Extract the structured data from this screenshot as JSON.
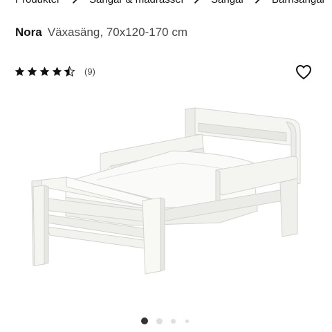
{
  "breadcrumb": {
    "items": [
      {
        "label": "Produkter"
      },
      {
        "label": "Sängar & madrasser"
      },
      {
        "label": "Sängar"
      },
      {
        "label": "Barnsängar"
      }
    ]
  },
  "product": {
    "name": "Nora",
    "description": "Växasäng, 70x120-170 cm"
  },
  "rating": {
    "stars": 4.5,
    "max_stars": 5,
    "review_count": "(9)"
  },
  "icons": {
    "favorite": "heart-outline-icon",
    "breadcrumb_separator": "chevron-right-icon",
    "star": "star-icon"
  },
  "carousel": {
    "current": 1,
    "total": 4
  },
  "colors": {
    "text": "#111111",
    "secondary_text": "#484848",
    "dot_active": "#333333",
    "dot_inactive": "#dfdfdf"
  }
}
